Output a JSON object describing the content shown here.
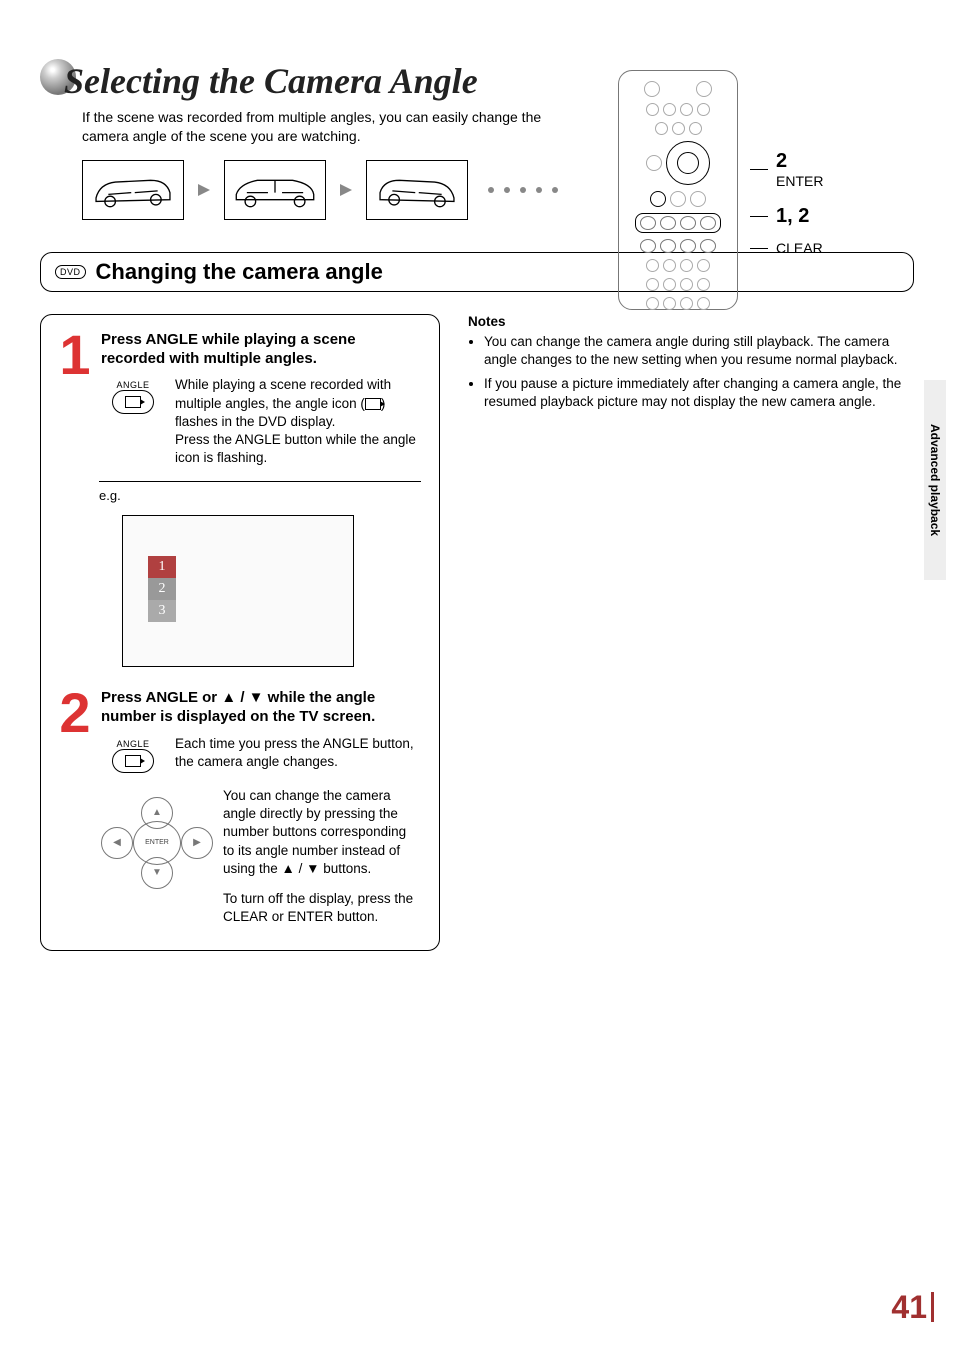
{
  "header": {
    "title": "Selecting the Camera Angle",
    "intro": "If the scene was recorded from multiple angles, you can easily change the camera angle of the scene you are watching."
  },
  "callouts": {
    "c1": "2",
    "c1_label": "ENTER",
    "c2": "1, 2",
    "c3_label": "CLEAR"
  },
  "section": {
    "badge": "DVD",
    "title": "Changing the camera angle"
  },
  "step1": {
    "num": "1",
    "heading": "Press ANGLE while playing a scene recorded with multiple angles.",
    "button_label": "ANGLE",
    "body_a": "While playing a scene recorded with multiple angles, the angle icon (",
    "body_b": ") flashes in the DVD display.",
    "body_c": "Press the ANGLE button while the angle icon is flashing.",
    "eg": "e.g.",
    "opt1": "1",
    "opt2": "2",
    "opt3": "3"
  },
  "step2": {
    "num": "2",
    "heading": "Press ANGLE or ▲ / ▼ while the angle number is displayed on the TV screen.",
    "button_label": "ANGLE",
    "body1": "Each time you press the ANGLE button, the camera angle changes.",
    "body2": "You can change the camera angle directly by pressing the number buttons corresponding to its angle number instead of using the ▲ / ▼ buttons.",
    "body3": "To turn off the display, press the CLEAR or ENTER button.",
    "enter_label": "ENTER",
    "up": "▲",
    "down": "▼",
    "left": "◀",
    "right": "▶"
  },
  "notes": {
    "heading": "Notes",
    "n1": "You can change the camera angle during still playback. The camera angle changes to the new setting when you resume normal playback.",
    "n2": "If you pause a picture immediately after changing a camera angle, the resumed playback picture may not display the new camera angle."
  },
  "side_tab": "Advanced playback",
  "page_number": "41"
}
